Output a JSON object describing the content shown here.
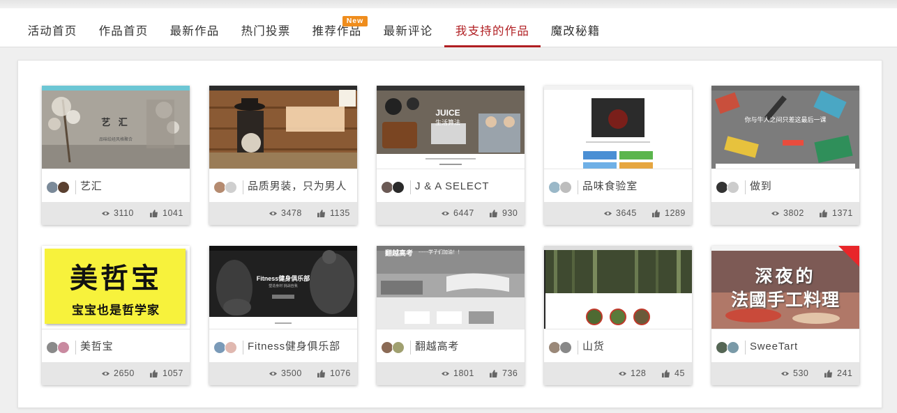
{
  "nav": {
    "items": [
      {
        "label": "活动首页",
        "active": false
      },
      {
        "label": "作品首页",
        "active": false
      },
      {
        "label": "最新作品",
        "active": false
      },
      {
        "label": "热门投票",
        "active": false
      },
      {
        "label": "推荐作品",
        "active": false
      },
      {
        "label": "最新评论",
        "active": false
      },
      {
        "label": "我支持的作品",
        "active": true
      },
      {
        "label": "魔改秘籍",
        "active": false
      }
    ],
    "new_badge": "New",
    "accent_color": "#b01e22"
  },
  "cards": [
    {
      "title": "艺汇",
      "views": "3110",
      "likes": "1041",
      "thumb": {
        "bg": "#a9a49b",
        "bar": "#6cc6d4",
        "title": "艺 汇",
        "sub": "品味绘经风格聚合"
      }
    },
    {
      "title": "品质男装，只为男人",
      "views": "3478",
      "likes": "1135",
      "thumb": {
        "bg": "#8a5a34",
        "bar": "#2b2b2b",
        "title": "",
        "sub": ""
      }
    },
    {
      "title": "J & A SELECT",
      "views": "6447",
      "likes": "930",
      "thumb": {
        "bg": "#6e655a",
        "bar": "#333333",
        "title": "JUICE",
        "sub": "生活算法"
      }
    },
    {
      "title": "品味食验室",
      "views": "3645",
      "likes": "1289",
      "thumb": {
        "bg": "#ffffff",
        "bar": "#f2f2f2",
        "title": "",
        "sub": ""
      }
    },
    {
      "title": "做到",
      "views": "3802",
      "likes": "1371",
      "thumb": {
        "bg": "#7c7c7c",
        "bar": "#6a6a6a",
        "title": "你与牛人之间只差这最后一课",
        "sub": ""
      }
    },
    {
      "title": "美哲宝",
      "views": "2650",
      "likes": "1057",
      "thumb": {
        "bg": "#f7f23c",
        "bar": "#f7f23c",
        "title": "美哲宝",
        "sub": "宝宝也是哲学家"
      }
    },
    {
      "title": "Fitness健身俱乐部",
      "views": "3500",
      "likes": "1076",
      "thumb": {
        "bg": "#202020",
        "bar": "#111111",
        "title": "Fitness健身俱乐部",
        "sub": "塑造身材 挑战自我"
      }
    },
    {
      "title": "翻越高考",
      "views": "1801",
      "likes": "736",
      "thumb": {
        "bg": "#8d8d8d",
        "bar": "#777777",
        "title": "翻越高考",
        "sub": "------学子们加油！！"
      }
    },
    {
      "title": "山货",
      "views": "128",
      "likes": "45",
      "thumb": {
        "bg": "#3f4a30",
        "bar": "#dddddd",
        "title": "",
        "sub": ""
      }
    },
    {
      "title": "SweeTart",
      "views": "530",
      "likes": "241",
      "thumb": {
        "bg": "#9a6a62",
        "bar": "#f3f3f3",
        "title": "深夜的",
        "sub": "法國手工料理"
      }
    }
  ]
}
